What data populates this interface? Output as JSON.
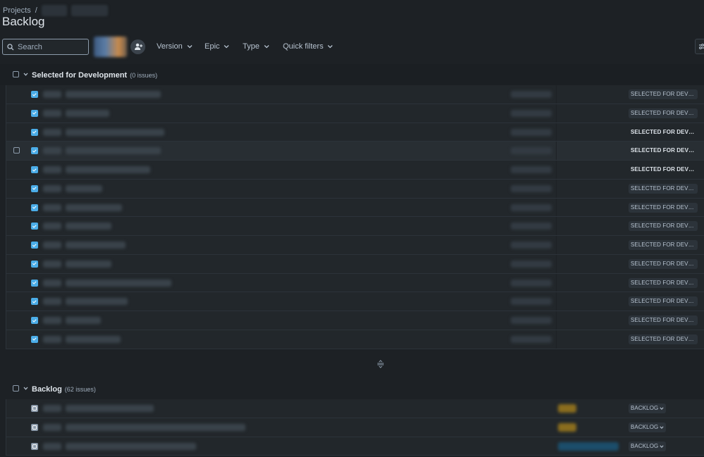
{
  "breadcrumb": {
    "root": "Projects",
    "separator": "/"
  },
  "page": {
    "title": "Backlog"
  },
  "toolbar": {
    "search_placeholder": "Search",
    "filters": [
      {
        "label": "Version"
      },
      {
        "label": "Epic"
      },
      {
        "label": "Type"
      },
      {
        "label": "Quick filters"
      }
    ]
  },
  "sections": {
    "selected": {
      "title": "Selected for Development",
      "count": "(0 issues)",
      "rows": [
        {
          "status": "SELECTED FOR DEVELOPM...",
          "bold": false,
          "icon": "task-icon"
        },
        {
          "status": "SELECTED FOR DEVELOPM...",
          "bold": false,
          "icon": "task-icon"
        },
        {
          "status": "SELECTED FOR DEVELOP...",
          "bold": true,
          "icon": "task-icon"
        },
        {
          "status": "SELECTED FOR DEVELOP...",
          "bold": true,
          "icon": "task-icon"
        },
        {
          "status": "SELECTED FOR DEVELOP...",
          "bold": true,
          "icon": "task-icon"
        },
        {
          "status": "SELECTED FOR DEVELOPM...",
          "bold": false,
          "icon": "task-icon"
        },
        {
          "status": "SELECTED FOR DEVELOPM...",
          "bold": false,
          "icon": "task-icon"
        },
        {
          "status": "SELECTED FOR DEVELOPM...",
          "bold": false,
          "icon": "task-icon"
        },
        {
          "status": "SELECTED FOR DEVELOPM...",
          "bold": false,
          "icon": "task-icon"
        },
        {
          "status": "SELECTED FOR DEVELOPM...",
          "bold": false,
          "icon": "task-icon"
        },
        {
          "status": "SELECTED FOR DEVELOPM...",
          "bold": false,
          "icon": "task-icon"
        },
        {
          "status": "SELECTED FOR DEVELOPM...",
          "bold": false,
          "icon": "task-icon"
        },
        {
          "status": "SELECTED FOR DEVELOPM...",
          "bold": false,
          "icon": "task-icon"
        },
        {
          "status": "SELECTED FOR DEVELOPM...",
          "bold": false,
          "icon": "task-icon"
        }
      ]
    },
    "backlog": {
      "title": "Backlog",
      "count": "(62 issues)",
      "rows": [
        {
          "status": "BACKLOG",
          "icon": "subtask-icon"
        },
        {
          "status": "BACKLOG",
          "icon": "subtask-icon"
        },
        {
          "status": "BACKLOG",
          "icon": "subtask-icon"
        }
      ]
    }
  },
  "colors": {
    "background": "#1d2125",
    "row": "#22272b",
    "task_icon": "#4bade8",
    "label_yellow": "#8a6d1e",
    "label_blue": "#1c4e6b"
  }
}
